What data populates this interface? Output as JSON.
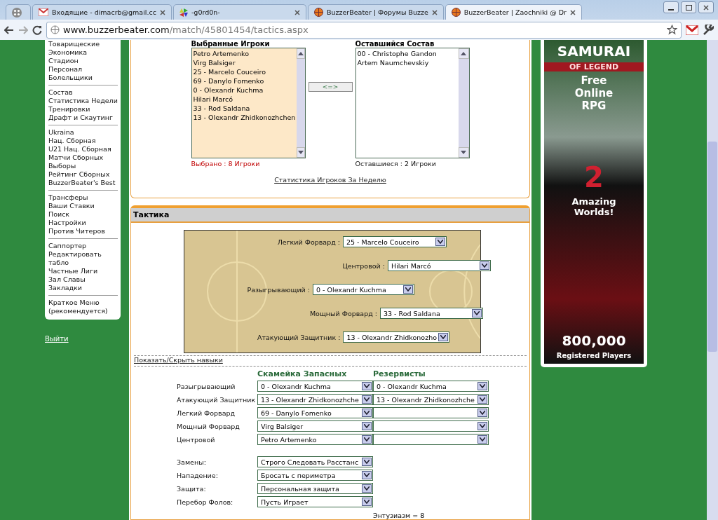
{
  "browser": {
    "tabs": [
      {
        "kind": "apps",
        "selected": false
      },
      {
        "kind": "mail",
        "title": "Входящие - dimacrb@gmail.cc",
        "selected": false
      },
      {
        "kind": "pinwheel",
        "title": "-g0rd0n-",
        "selected": false
      },
      {
        "kind": "ball",
        "title": "BuzzerBeater | Форумы Buzze",
        "selected": false
      },
      {
        "kind": "ball",
        "title": "BuzzerBeater | Zaochniki @ Dr",
        "selected": true
      }
    ],
    "url_host": "www.buzzerbeater.com",
    "url_path": "/match/45801454/tactics.aspx"
  },
  "sidebar": {
    "groups": [
      [
        "Товарищеские",
        "Экономика",
        "Стадион",
        "Персонал",
        "Болельщики"
      ],
      [
        "Состав",
        "Статистика Недели",
        "Тренировки",
        "Драфт и Скаутинг"
      ],
      [
        "Ukraina",
        "Нац. Сборная",
        "U21 Нац. Сборная",
        "Матчи Сборных",
        "Выборы",
        "Рейтинг Сборных",
        "BuzzerBeater's Best"
      ],
      [
        "Трансферы",
        "Ваши Ставки",
        "Поиск",
        "Настройки",
        "Против Читеров"
      ],
      [
        "Саппортер",
        "Редактировать табло",
        "Частные Лиги",
        "Зал Славы",
        "Закладки"
      ],
      [
        "Краткое Меню (рекомендуется)"
      ]
    ],
    "logout": "Выйти"
  },
  "lineup": {
    "selected_title": "Выбранные Игроки",
    "remaining_title": "Оставшийся Состав",
    "selected_players": [
      "Petro Artemenko",
      "Virg Balsiger",
      "25 - Marcelo Couceiro",
      "69 - Danylo Fomenko",
      "0 - Olexandr Kuchma",
      "Hilari Marcó",
      "33 - Rod Saldana",
      "13 - Olexandr Zhidkonozhchen"
    ],
    "remaining_players": [
      "00 - Christophe Gandon",
      "Artem Naumchevskiy"
    ],
    "swap_button": "<=>",
    "selected_count": "Выбрано : 8 Игроки",
    "remaining_count": "Оставшиеся : 2 Игроки",
    "weekly_stats_link": "Статистика Игроков За Неделю"
  },
  "tactics": {
    "title": "Тактика",
    "starters": [
      {
        "label": "Легкий Форвард :",
        "value": "25 - Marcelo Couceiro"
      },
      {
        "label": "Центровой :",
        "value": "Hilari Marcó"
      },
      {
        "label": "Разыгрывающий :",
        "value": "0 - Olexandr Kuchma"
      },
      {
        "label": "Мощный Форвард :",
        "value": "33 - Rod Saldana"
      },
      {
        "label": "Атакующий Защитник :",
        "value": "13 - Olexandr Zhidkonozho"
      }
    ],
    "skills_link": "Показать/Скрыть навыки",
    "bench_header": "Скамейка Запасных",
    "reserve_header": "Резервисты",
    "bench": [
      {
        "label": "Разыгрывающий",
        "bench": "0 - Olexandr Kuchma",
        "reserve": "0 - Olexandr Kuchma"
      },
      {
        "label": "Атакующий Защитник",
        "bench": "13 - Olexandr Zhidkonozhche",
        "reserve": "13 - Olexandr Zhidkonozhche"
      },
      {
        "label": "Легкий Форвард",
        "bench": "69 - Danylo Fomenko"
      },
      {
        "label": "Мощный Форвард",
        "bench": "Virg Balsiger"
      },
      {
        "label": "Центровой",
        "bench": "Petro Artemenko"
      }
    ],
    "settings": [
      {
        "label": "Замены:",
        "value": "Строго Следовать Расстанс"
      },
      {
        "label": "Нападение:",
        "value": "Бросать с периметра"
      },
      {
        "label": "Защита:",
        "value": "Персональная защита"
      },
      {
        "label": "Перебор Фолов:",
        "value": "Пусть Играет"
      }
    ],
    "enthusiasm": "Энтузиазм = 8"
  },
  "ad": {
    "title": "SAMURAI",
    "subtitle": "OF LEGEND",
    "tagline": "Free Online RPG",
    "number": "2",
    "worlds": "Amazing Worlds!",
    "players_count": "800,000",
    "players_label": "Registered Players"
  }
}
